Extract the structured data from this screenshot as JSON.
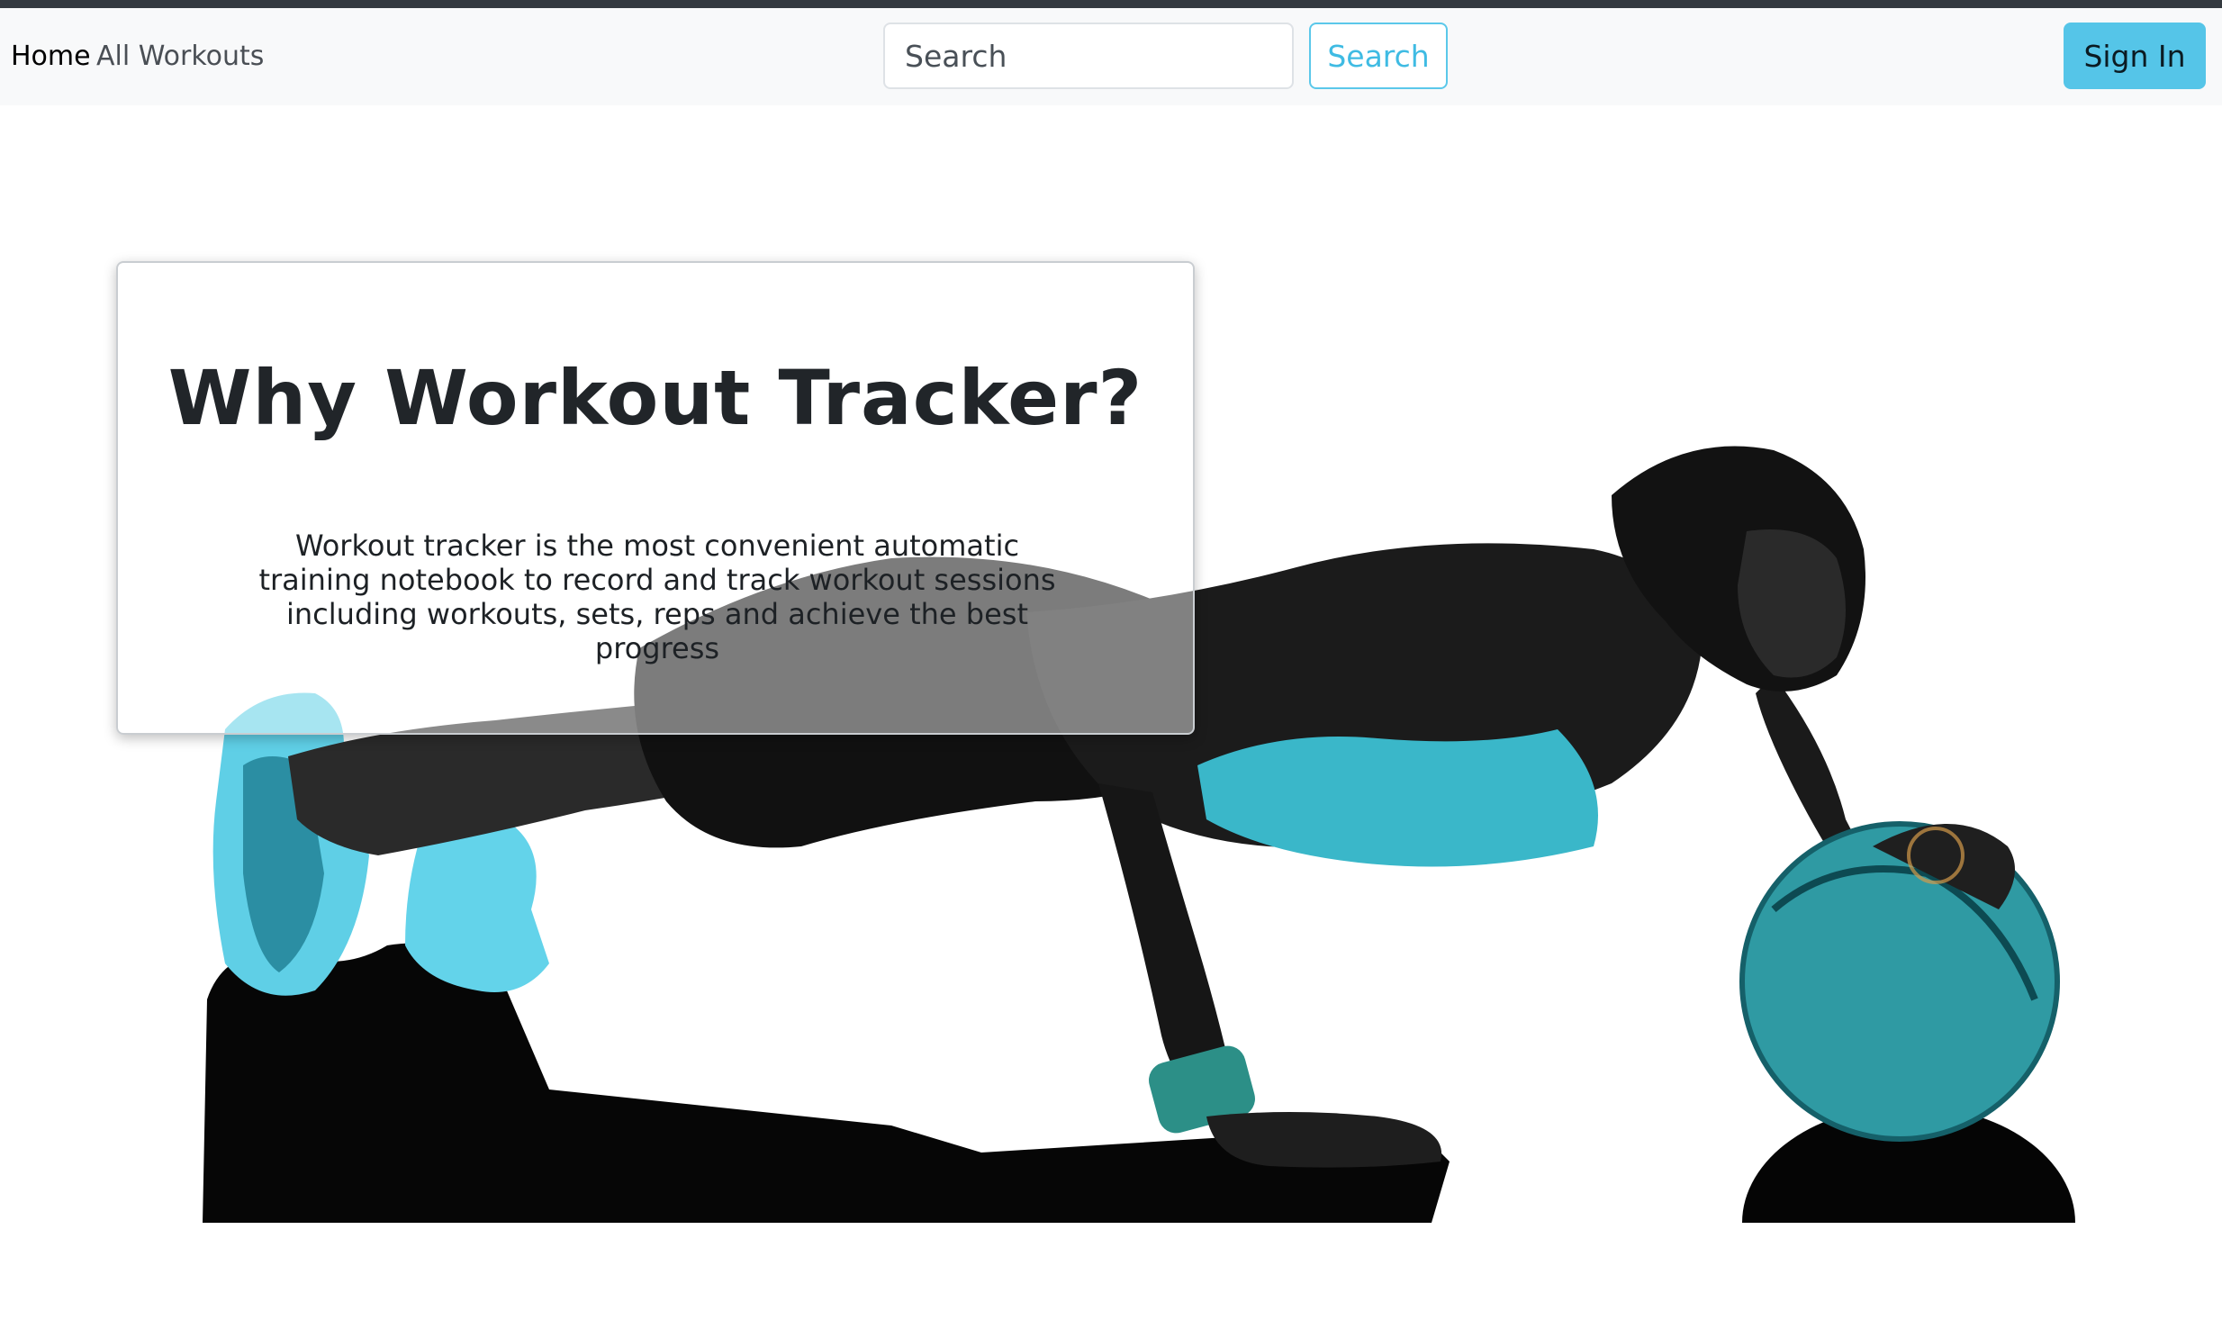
{
  "navbar": {
    "home_label": "Home",
    "all_workouts_label": "All Workouts",
    "search_placeholder": "Search",
    "search_button_label": "Search",
    "sign_in_label": "Sign In"
  },
  "hero": {
    "image": "woman-pushup-medicine-ball-photo",
    "accent_color": "#3ab7c9"
  },
  "card": {
    "title": "Why Workout Tracker?",
    "description": "Workout tracker is the most convenient automatic training notebook to record and track workout sessions including workouts, sets, reps and achieve the best progress"
  },
  "colors": {
    "primary_info": "#55c5e8",
    "navbar_bg": "#f8f9fa",
    "top_strip": "#343a40"
  }
}
